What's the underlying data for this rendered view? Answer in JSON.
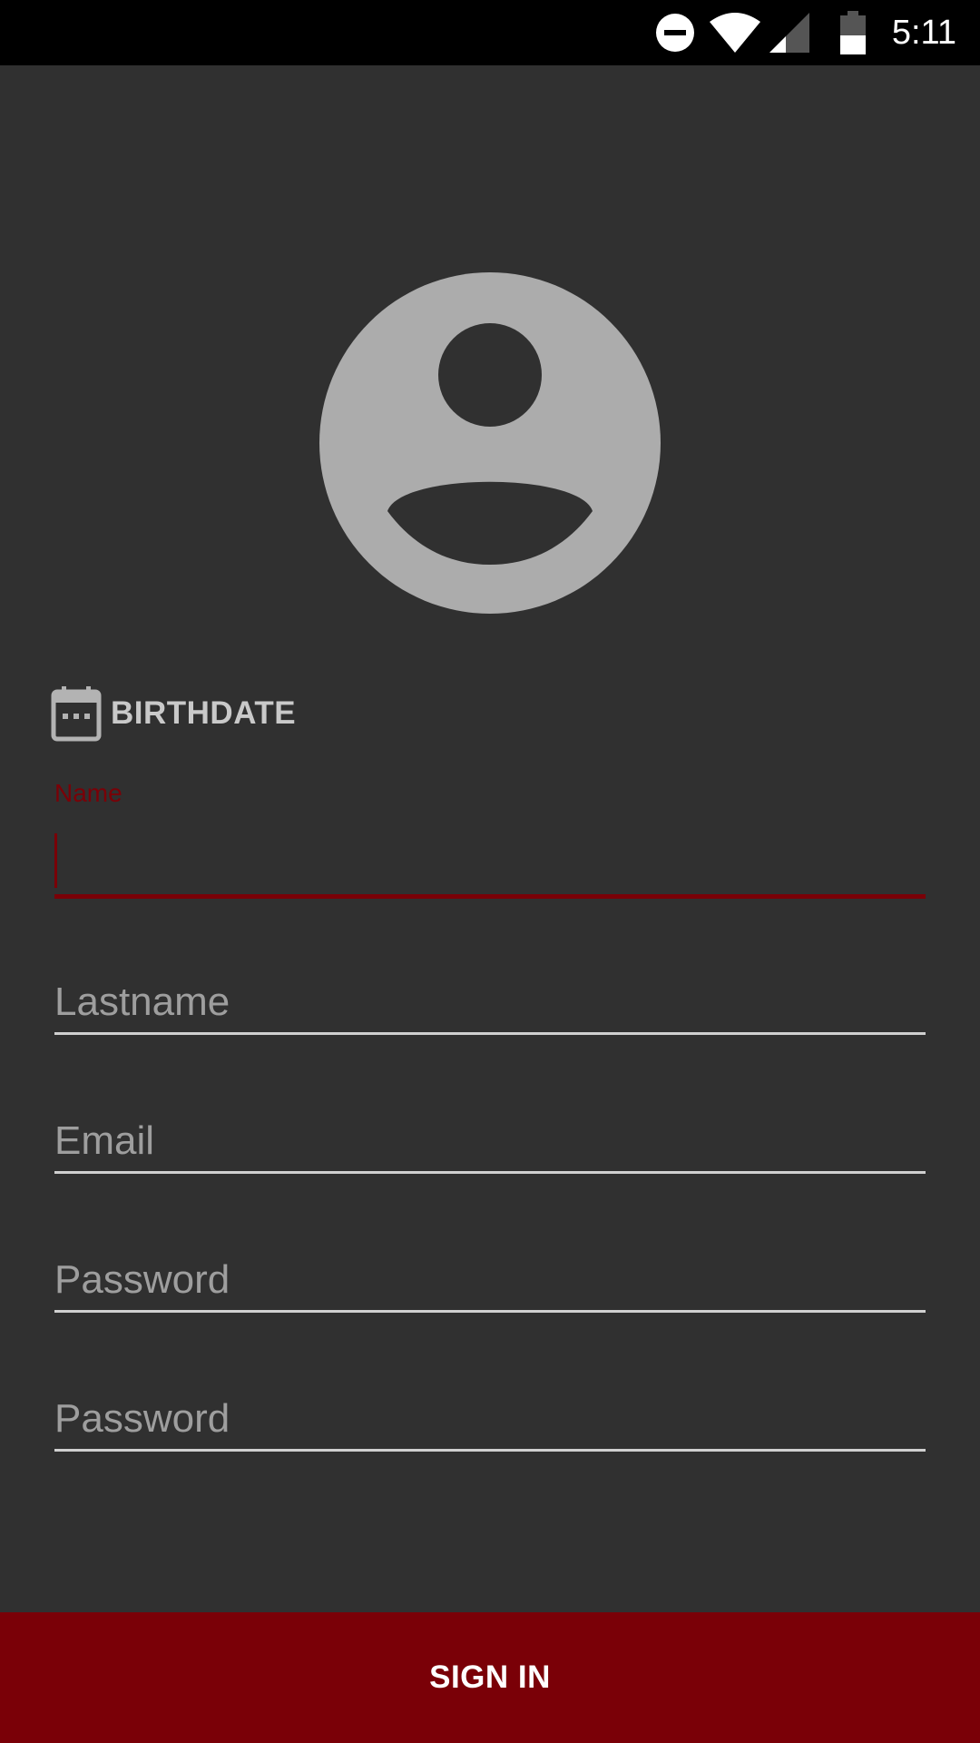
{
  "status_bar": {
    "time": "5:11",
    "icons": [
      "do-not-disturb-icon",
      "wifi-icon",
      "cell-signal-icon",
      "battery-icon"
    ]
  },
  "avatar": {
    "icon": "account-circle-icon"
  },
  "birthdate": {
    "icon": "calendar-icon",
    "label": "BIRTHDATE"
  },
  "form": {
    "name": {
      "label": "Name",
      "value": ""
    },
    "lastname": {
      "placeholder": "Lastname",
      "value": ""
    },
    "email": {
      "placeholder": "Email",
      "value": ""
    },
    "password": {
      "placeholder": "Password",
      "value": ""
    },
    "confirm_password": {
      "placeholder": "Password",
      "value": ""
    }
  },
  "sign_in": {
    "label": "SIGN IN"
  },
  "colors": {
    "background": "#303030",
    "accent": "#7a0007",
    "status_bar": "#000000",
    "avatar": "#acacac",
    "hint_text": "#9e9e9e"
  }
}
